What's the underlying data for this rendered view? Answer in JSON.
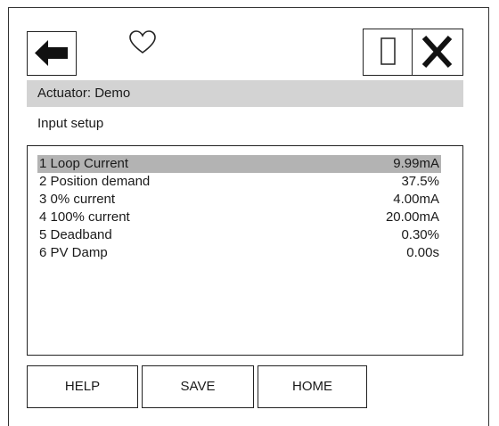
{
  "header": {
    "back_icon": "left-arrow-icon",
    "favorite_icon": "heart-icon",
    "box_icon": "rectangle-icon",
    "close_icon": "close-x-icon"
  },
  "title_bar": {
    "text": "Actuator: Demo"
  },
  "subtitle": {
    "text": "Input setup"
  },
  "list": {
    "items": [
      {
        "label": "1 Loop Current",
        "value": "9.99mA",
        "selected": true
      },
      {
        "label": "2 Position demand",
        "value": "37.5%",
        "selected": false
      },
      {
        "label": "3 0% current",
        "value": "4.00mA",
        "selected": false
      },
      {
        "label": "4 100% current",
        "value": "20.00mA",
        "selected": false
      },
      {
        "label": "5 Deadband",
        "value": "0.30%",
        "selected": false
      },
      {
        "label": "6 PV Damp",
        "value": "0.00s",
        "selected": false
      }
    ]
  },
  "buttons": {
    "help": "HELP",
    "save": "SAVE",
    "home": "HOME"
  },
  "colors": {
    "title_bar_bg": "#d3d3d3",
    "selected_row_bg": "#b3b3b3",
    "border": "#222222"
  }
}
